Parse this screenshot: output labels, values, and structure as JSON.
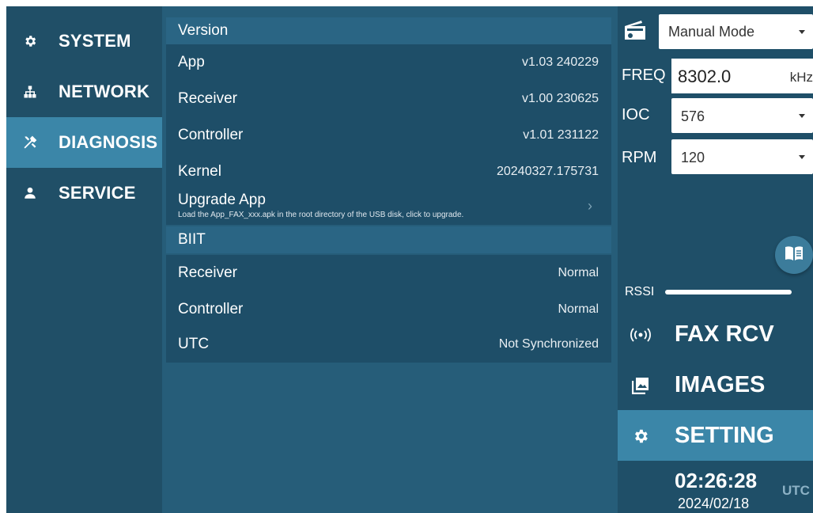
{
  "left_nav": {
    "items": [
      {
        "label": "SYSTEM",
        "icon": "gear-icon"
      },
      {
        "label": "NETWORK",
        "icon": "network-icon"
      },
      {
        "label": "DIAGNOSIS",
        "icon": "tools-icon",
        "active": true
      },
      {
        "label": "SERVICE",
        "icon": "person-icon"
      }
    ]
  },
  "version": {
    "header": "Version",
    "rows": [
      {
        "label": "App",
        "value": "v1.03 240229"
      },
      {
        "label": "Receiver",
        "value": "v1.00 230625"
      },
      {
        "label": "Controller",
        "value": "v1.01 231122"
      },
      {
        "label": "Kernel",
        "value": "20240327.175731"
      }
    ],
    "upgrade": {
      "title": "Upgrade App",
      "description": "Load the App_FAX_xxx.apk in the root directory of the USB disk, click to upgrade."
    }
  },
  "biit": {
    "header": "BIIT",
    "rows": [
      {
        "label": "Receiver",
        "value": "Normal"
      },
      {
        "label": "Controller",
        "value": "Normal"
      },
      {
        "label": "UTC",
        "value": "Not Synchronized"
      }
    ]
  },
  "receiver_panel": {
    "mode": "Manual Mode",
    "freq_label": "FREQ",
    "freq_value": "8302.0",
    "freq_unit": "kHz",
    "ioc_label": "IOC",
    "ioc_value": "576",
    "rpm_label": "RPM",
    "rpm_value": "120",
    "rssi_label": "RSSI",
    "rssi_level": 0.95
  },
  "right_nav": {
    "items": [
      {
        "label": "FAX RCV",
        "icon": "broadcast-icon"
      },
      {
        "label": "IMAGES",
        "icon": "images-icon"
      },
      {
        "label": "SETTING",
        "icon": "gear-icon",
        "active": true
      }
    ]
  },
  "status": {
    "time": "02:26:28",
    "date": "2024/02/18",
    "timezone": "UTC"
  },
  "colors": {
    "nav_bg": "#204f67",
    "panel_bg": "#265d79",
    "row_bg": "#1e4e68",
    "active_bg": "#3b86a8"
  }
}
